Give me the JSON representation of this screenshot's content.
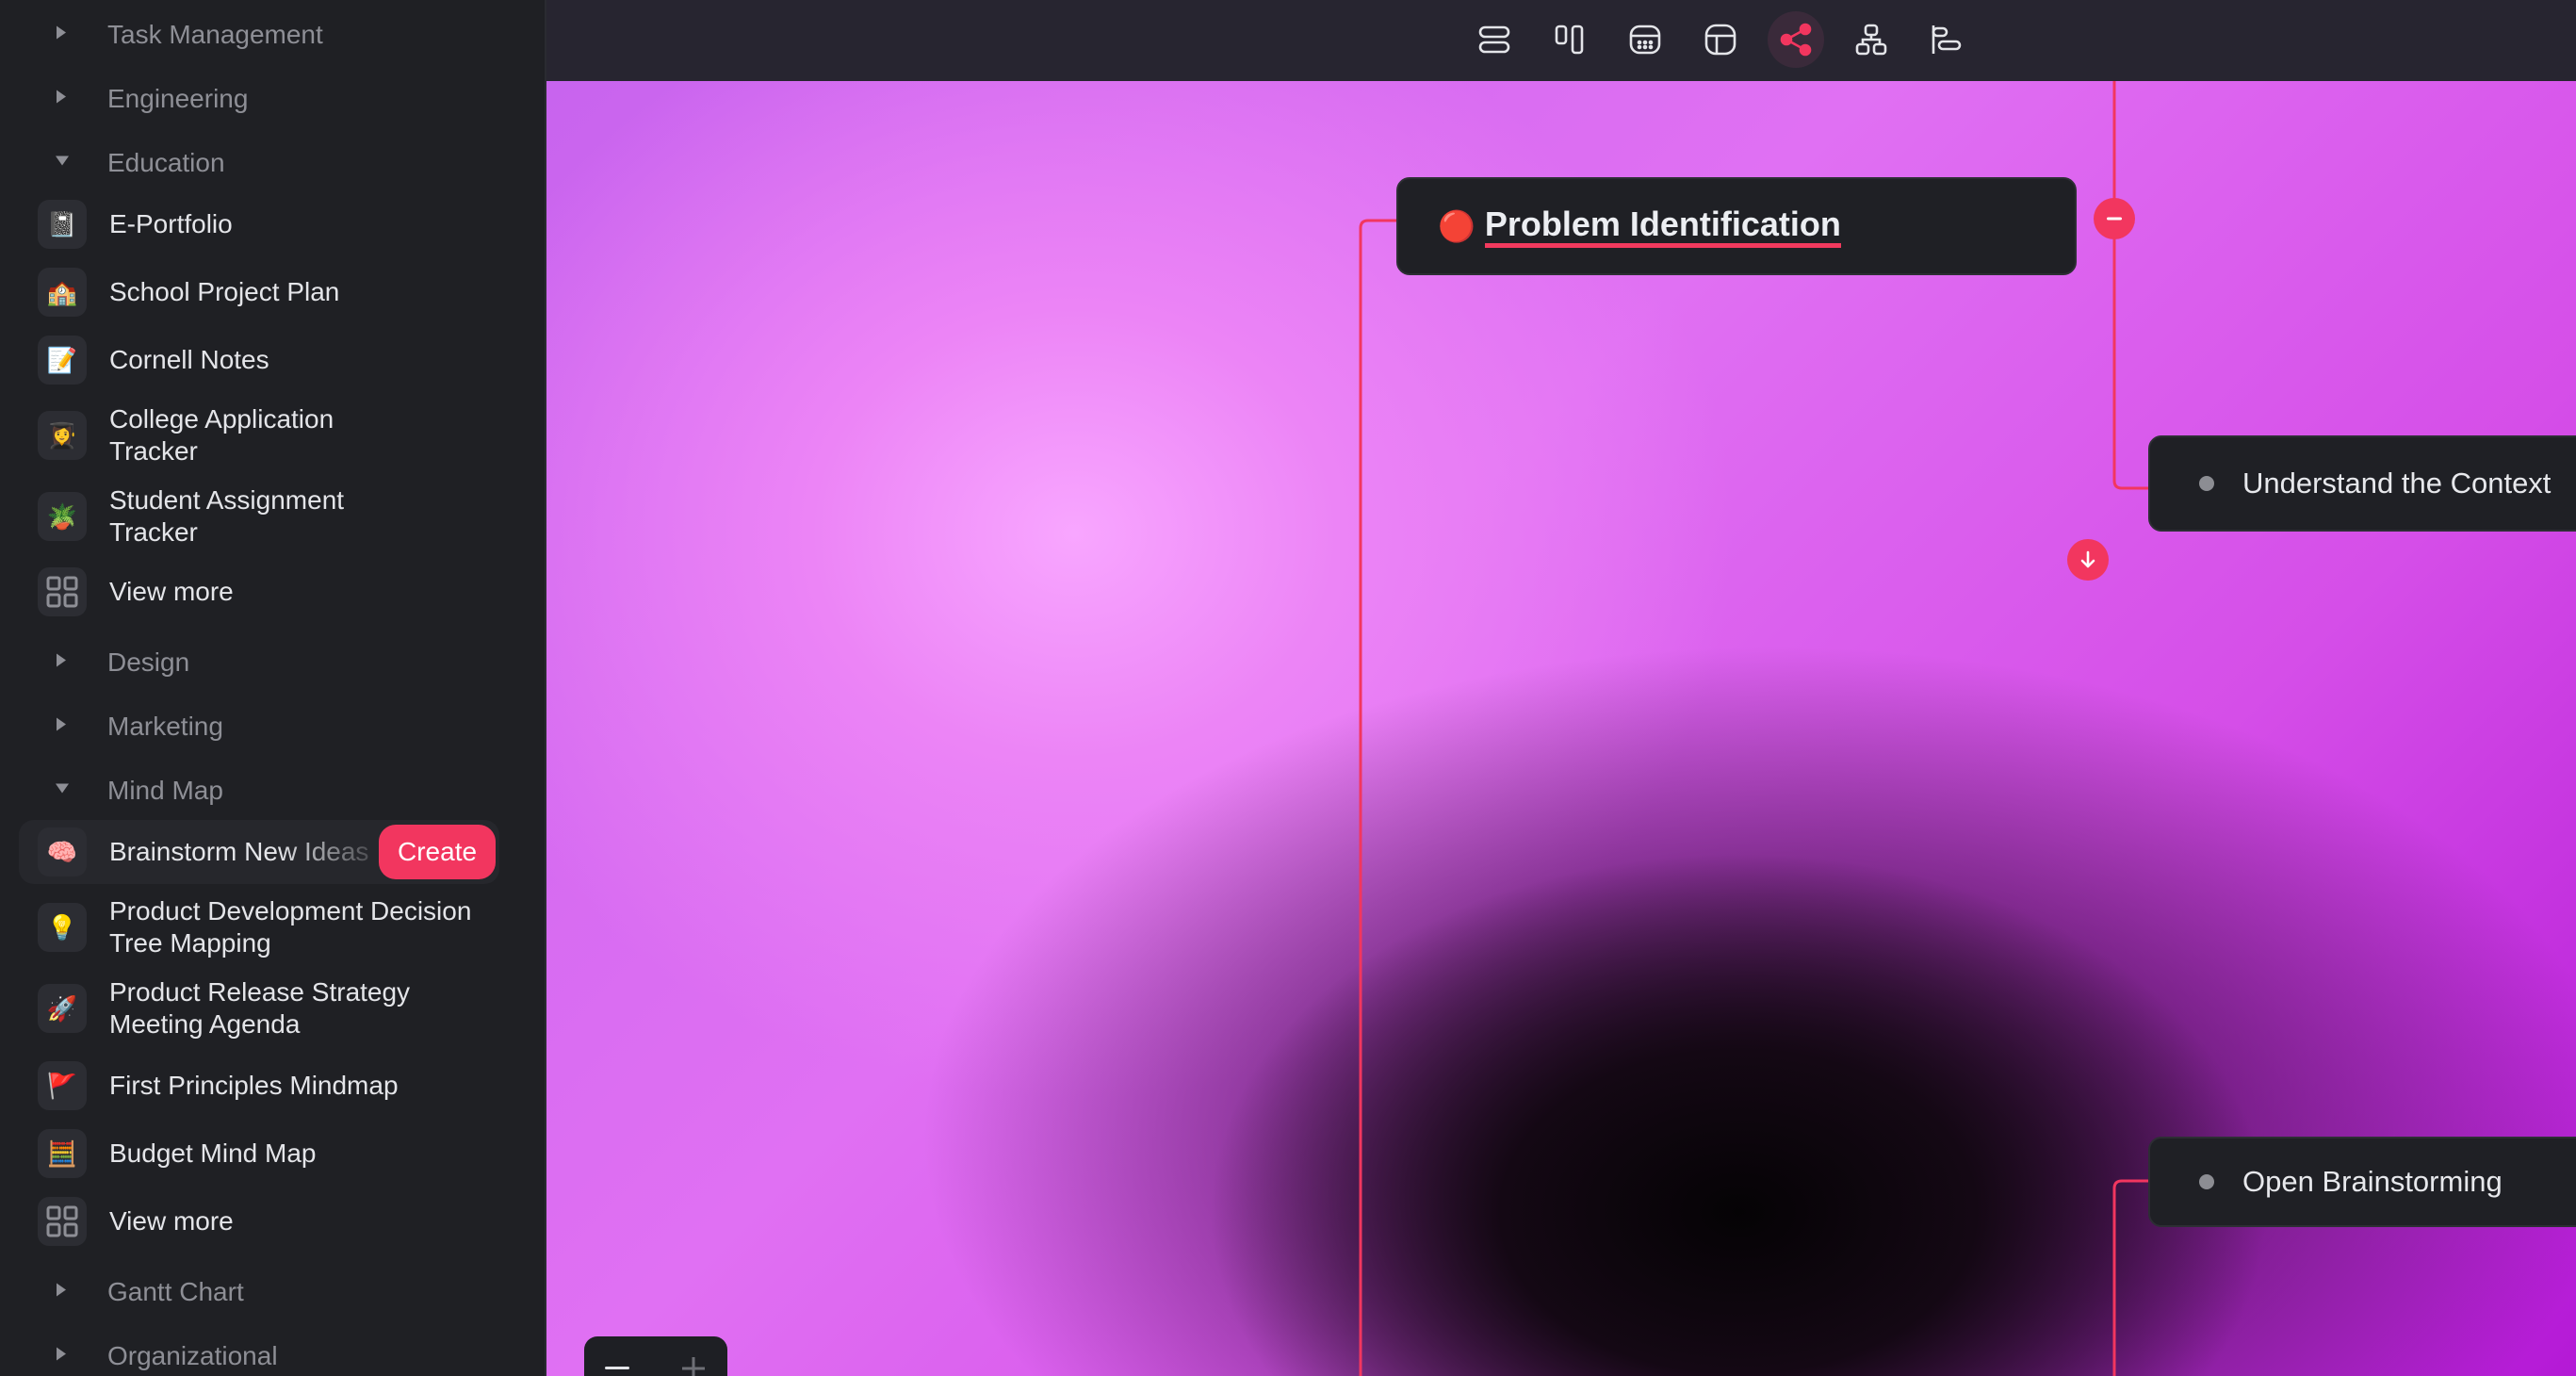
{
  "sidebar": {
    "categories": {
      "task_management": "Task Management",
      "engineering": "Engineering",
      "education": "Education",
      "design": "Design",
      "marketing": "Marketing",
      "mind_map": "Mind Map",
      "gantt_chart": "Gantt Chart",
      "organizational": "Organizational"
    },
    "education_items": [
      {
        "icon": "notebook-icon",
        "emoji": "📓",
        "label": "E-Portfolio"
      },
      {
        "icon": "school-icon",
        "emoji": "🏫",
        "label": "School Project Plan"
      },
      {
        "icon": "memo-icon",
        "emoji": "📝",
        "label": "Cornell Notes"
      },
      {
        "icon": "student-icon",
        "emoji": "👩‍🎓",
        "label": "College Application Tracker"
      },
      {
        "icon": "plant-icon",
        "emoji": "🪴",
        "label": "Student Assignment Tracker"
      }
    ],
    "mind_map_items": [
      {
        "icon": "brain-icon",
        "emoji": "🧠",
        "label": "Brainstorm New Ideas"
      },
      {
        "icon": "lightbulb-icon",
        "emoji": "💡",
        "label": "Product Development Decision Tree Mapping"
      },
      {
        "icon": "rocket-icon",
        "emoji": "🚀",
        "label": "Product Release Strategy Meeting Agenda"
      },
      {
        "icon": "flag-icon",
        "emoji": "🚩",
        "label": "First Principles Mindmap"
      },
      {
        "icon": "abacus-icon",
        "emoji": "🧮",
        "label": "Budget Mind Map"
      }
    ],
    "view_more": "View more",
    "create": "Create"
  },
  "toolbar": {
    "views": [
      "list-view-icon",
      "board-view-icon",
      "calendar-view-icon",
      "table-view-icon",
      "mindmap-view-icon",
      "org-chart-view-icon",
      "gantt-view-icon"
    ],
    "active": "mindmap-view-icon"
  },
  "mindmap": {
    "root": {
      "emoji": "🔴",
      "label": "Problem Identification"
    },
    "children": [
      "Understand the Context",
      "Open Brainstorming"
    ]
  },
  "colors": {
    "accent": "#f2365f",
    "sidebar_bg": "#1f2024",
    "node_bg": "#1f2025",
    "toolbar_bg": "#272530"
  }
}
